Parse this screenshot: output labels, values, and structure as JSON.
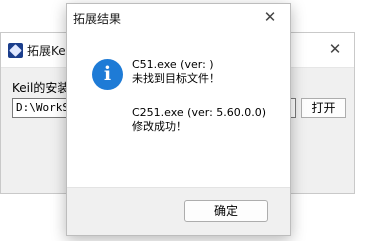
{
  "background_window": {
    "title": "拓展Keil",
    "label": "Keil的安装",
    "path_value": "D:\\WorkSo",
    "open_button": "打开",
    "close_glyph": "✕"
  },
  "dialog": {
    "title": "拓展结果",
    "close_glyph": "✕",
    "icon": "info-icon",
    "messages": [
      "C51.exe (ver: )",
      "未找到目标文件！",
      "C251.exe (ver: 5.60.0.0)",
      "修改成功！"
    ],
    "ok_button": "确定"
  },
  "colors": {
    "accent": "#1e7bd6",
    "background": "#f0f0f0"
  }
}
